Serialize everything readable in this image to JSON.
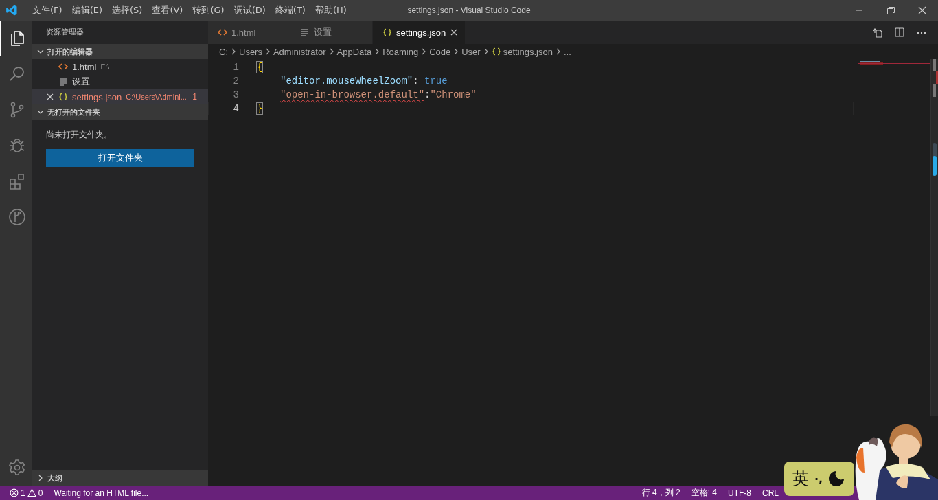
{
  "title_bar": {
    "menu": [
      "文件(F)",
      "编辑(E)",
      "选择(S)",
      "查看(V)",
      "转到(G)",
      "调试(D)",
      "终端(T)",
      "帮助(H)"
    ],
    "title": "settings.json - Visual Studio Code"
  },
  "activity_bar": [
    {
      "kind": "files",
      "selected": true
    },
    {
      "kind": "search",
      "selected": false
    },
    {
      "kind": "source-control",
      "selected": false
    },
    {
      "kind": "debug",
      "selected": false
    },
    {
      "kind": "extensions",
      "selected": false
    },
    {
      "kind": "branch",
      "selected": false
    }
  ],
  "sidebar": {
    "title": "资源管理器",
    "open_editors": {
      "title": "打开的编辑器",
      "expanded": true,
      "items": [
        {
          "kind": "html",
          "name": "1.html",
          "path": "F:\\",
          "selected": false,
          "error": false
        },
        {
          "kind": "settings",
          "name": "设置",
          "selected": false,
          "error": false
        },
        {
          "kind": "json",
          "name": "settings.json",
          "path": "C:\\Users\\Admini...",
          "problems": "1",
          "selected": true,
          "error": true
        }
      ]
    },
    "folder": {
      "title": "无打开的文件夹",
      "expanded": true,
      "message": "尚未打开文件夹。",
      "button": "打开文件夹"
    },
    "outline": {
      "title": "大纲",
      "expanded": false
    }
  },
  "tabs": [
    {
      "kind": "html",
      "label": "1.html",
      "selected": false
    },
    {
      "kind": "settings",
      "label": "设置",
      "selected": false
    },
    {
      "kind": "json",
      "label": "settings.json",
      "selected": true
    }
  ],
  "breadcrumb": [
    {
      "label": "C:"
    },
    {
      "label": "Users"
    },
    {
      "label": "Administrator"
    },
    {
      "label": "AppData"
    },
    {
      "label": "Roaming"
    },
    {
      "label": "Code"
    },
    {
      "label": "User"
    },
    {
      "label": "settings.json",
      "kind": "json"
    },
    {
      "label": "..."
    }
  ],
  "code": [
    {
      "number": "1",
      "indented": false,
      "current": false,
      "tokens": [
        {
          "text": "{",
          "kind": "bracket",
          "squiggle": false
        }
      ]
    },
    {
      "number": "2",
      "indented": true,
      "current": false,
      "tokens": [
        {
          "text": "\"editor.mouseWheelZoom\"",
          "kind": "key",
          "squiggle": false
        },
        {
          "text": ": ",
          "kind": "punct",
          "squiggle": false
        },
        {
          "text": "true",
          "kind": "bool",
          "squiggle": false
        }
      ]
    },
    {
      "number": "3",
      "indented": true,
      "current": false,
      "tokens": [
        {
          "text": "\"open-in-browser.default\"",
          "kind": "key-error",
          "squiggle": true
        },
        {
          "text": ":",
          "kind": "punct",
          "squiggle": false
        },
        {
          "text": "\"Chrome\"",
          "kind": "string",
          "squiggle": false
        }
      ]
    },
    {
      "number": "4",
      "indented": false,
      "current": true,
      "tokens": [
        {
          "text": "}",
          "kind": "bracket",
          "squiggle": false
        }
      ]
    }
  ],
  "status_bar": {
    "errors": "1",
    "warnings": "0",
    "message": "Waiting for an HTML file...",
    "right": [
      "行 4，列 2",
      "空格: 4",
      "UTF-8",
      "CRL"
    ]
  },
  "ime": {
    "mode": "英",
    "punct": "·,"
  }
}
